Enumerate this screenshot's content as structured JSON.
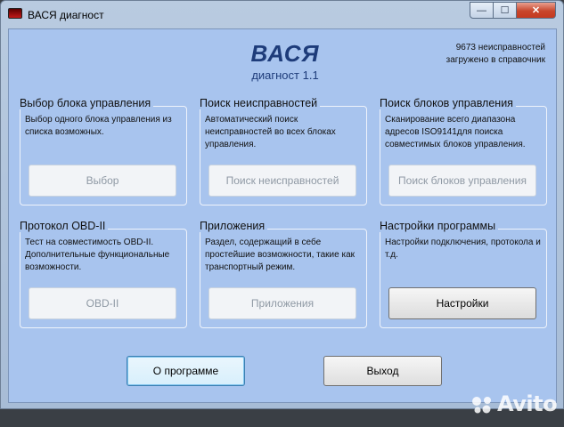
{
  "window": {
    "title": "ВАСЯ диагност",
    "controls": {
      "minimize": "—",
      "maximize": "☐",
      "close": "✕"
    }
  },
  "logo": {
    "title": "ВАСЯ",
    "subtitle": "диагност 1.1"
  },
  "db_info": {
    "line1": "9673 неисправностей",
    "line2": "загружено в справочник"
  },
  "groups": [
    {
      "title": "Выбор блока управления",
      "desc": "Выбор одного блока управления из списка возможных.",
      "button": "Выбор",
      "enabled": false
    },
    {
      "title": "Поиск неисправностей",
      "desc": "Автоматический поиск неисправностей во всех блоках управления.",
      "button": "Поиск неисправностей",
      "enabled": false
    },
    {
      "title": "Поиск блоков управления",
      "desc": "Сканирование всего диапазона адресов ISO9141для поиска совместимых блоков управления.",
      "button": "Поиск блоков управления",
      "enabled": false
    },
    {
      "title": "Протокол OBD-II",
      "desc": "Тест на совместимость OBD-II. Дополнительные функциональные возможности.",
      "button": "OBD-II",
      "enabled": false
    },
    {
      "title": "Приложения",
      "desc": "Раздел, содержащий в себе простейшие возможности, такие как транспортный режим.",
      "button": "Приложения",
      "enabled": false
    },
    {
      "title": "Настройки программы",
      "desc": "Настройки подключения, протокола и т.д.",
      "button": "Настройки",
      "enabled": true
    }
  ],
  "bottom": {
    "about": "О программе",
    "exit": "Выход"
  },
  "watermark": "Avito"
}
